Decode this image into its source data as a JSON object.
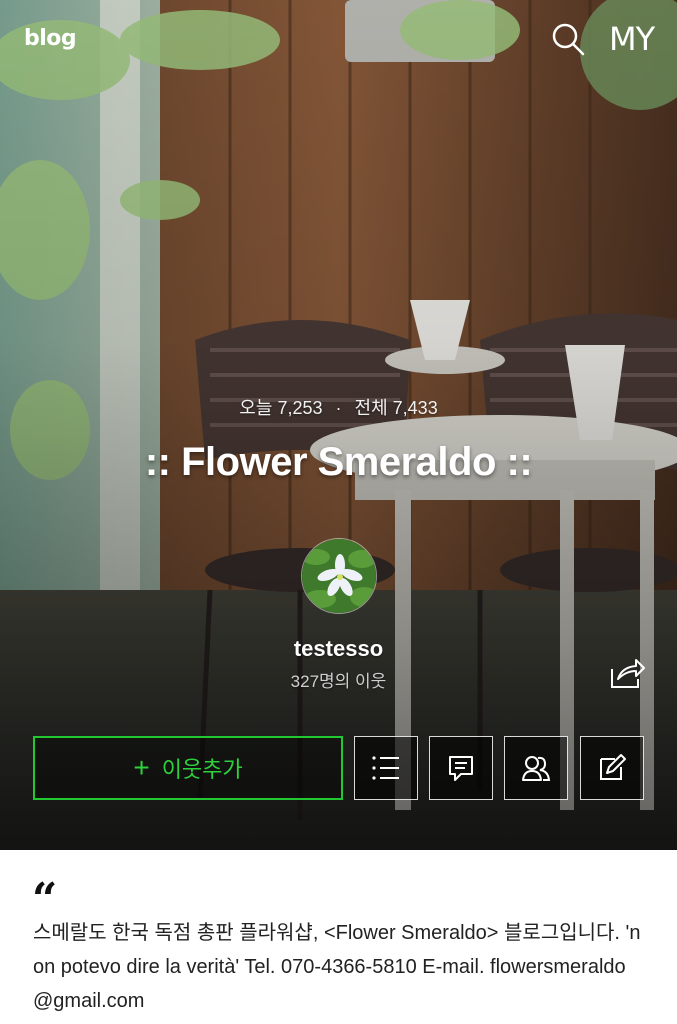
{
  "header": {
    "logo": "blog",
    "search_icon": "search-icon",
    "my_label": "MY"
  },
  "stats": {
    "today_label": "오늘",
    "today_count": "7,253",
    "separator": "·",
    "total_label": "전체",
    "total_count": "7,433"
  },
  "blog": {
    "title": ":: Flower Smeraldo ::"
  },
  "profile": {
    "username": "testesso",
    "neighbors": "327명의 이웃"
  },
  "actions": {
    "add_neighbor_plus": "+",
    "add_neighbor_label": "이웃추가",
    "accent_color": "#22c832",
    "icons": [
      "list-icon",
      "comment-icon",
      "people-icon",
      "write-icon",
      "share-icon"
    ]
  },
  "description": {
    "quote": "“",
    "text": "스메랄도 한국 독점 총판 플라워샵, <Flower Smeraldo> 블로그입니다. 'non potevo dire la verità' Tel. 070-4366-5810 E-mail. flowersmeraldo@gmail.com"
  }
}
